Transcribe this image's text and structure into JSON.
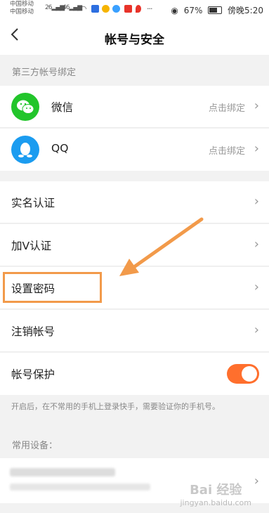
{
  "status_bar": {
    "carrier_1": "中国移动",
    "carrier_2": "中国移动",
    "signal_1": "26",
    "signal_2": "46",
    "battery": "67%",
    "time": "傍晚5:20"
  },
  "header": {
    "title": "帐号与安全",
    "back_icon": "chevron-left-icon"
  },
  "third_party": {
    "title": "第三方帐号绑定",
    "items": [
      {
        "label": "微信",
        "action": "点击绑定",
        "icon": "wechat-icon",
        "color": "#22c52b"
      },
      {
        "label": "QQ",
        "action": "点击绑定",
        "icon": "qq-icon",
        "color": "#1b9cf0"
      }
    ]
  },
  "settings": {
    "items": [
      {
        "label": "实名认证"
      },
      {
        "label": "加V认证"
      },
      {
        "label": "设置密码"
      },
      {
        "label": "注销帐号"
      }
    ],
    "protection": {
      "label": "帐号保护",
      "enabled": true,
      "color": "#ff6f2d"
    },
    "note": "开启后，在不常用的手机上登录快手，需要验证你的手机号。"
  },
  "devices": {
    "title": "常用设备："
  },
  "annotation": {
    "color": "#f29a4a"
  },
  "watermark": {
    "text": "Bai 经验",
    "sub": "jingyan.baidu.com"
  }
}
